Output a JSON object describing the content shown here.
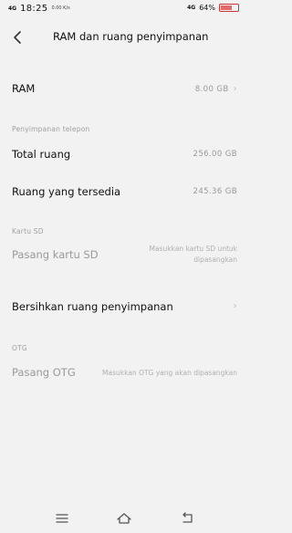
{
  "status_bar": {
    "network": "4G",
    "time": "18:25",
    "speed": "0.00 K/s",
    "network_right": "4G",
    "battery": "64%",
    "battery_level": 0.64
  },
  "header": {
    "title": "RAM dan ruang penyimpanan"
  },
  "ram": {
    "label": "RAM",
    "value": "8.00 GB"
  },
  "phone_storage": {
    "section": "Penyimpanan telepon",
    "total_label": "Total ruang",
    "total_value": "256.00 GB",
    "available_label": "Ruang yang tersedia",
    "available_value": "245.36 GB"
  },
  "sd_card": {
    "section": "Kartu SD",
    "mount_label": "Pasang kartu SD",
    "hint_line1": "Masukkan kartu SD untuk",
    "hint_line2": "dipasangkan"
  },
  "cleanup": {
    "label": "Bersihkan ruang penyimpanan"
  },
  "otg": {
    "section": "OTG",
    "mount_label": "Pasang OTG",
    "hint": "Masukkan OTG yang akan dipasangkan"
  }
}
